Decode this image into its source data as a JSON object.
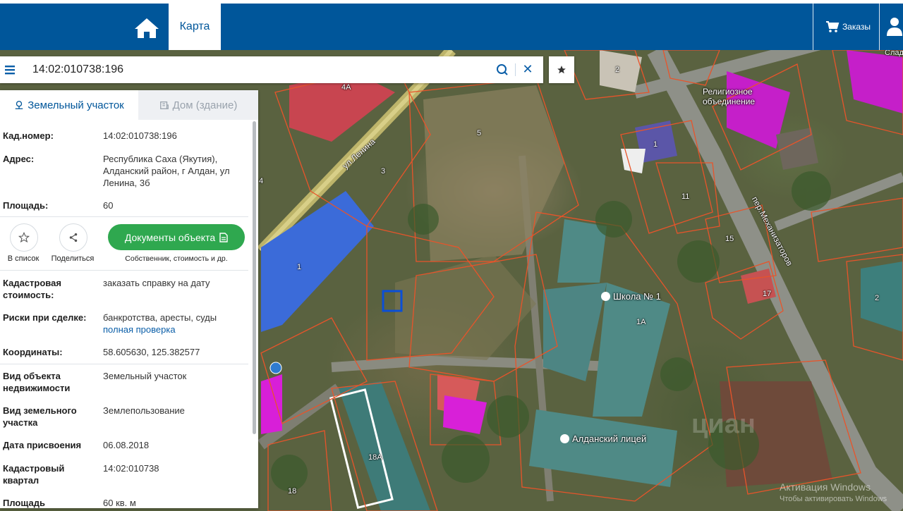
{
  "nav": {
    "tab_label": "Карта",
    "orders_label": "Заказы"
  },
  "search": {
    "value": "14:02:010738:196"
  },
  "panel": {
    "tab_land": "Земельный участок",
    "tab_house": "Дом (здание)",
    "rows": {
      "cad_number": {
        "label": "Кад.номер:",
        "value": "14:02:010738:196"
      },
      "address": {
        "label": "Адрес:",
        "value": "Республика Саха (Якутия), Алданский район, г Алдан, ул Ленина, 3б"
      },
      "area": {
        "label": "Площадь:",
        "value": "60"
      },
      "cad_value": {
        "label": "Кадастровая стоимость:",
        "value": "заказать справку на дату"
      },
      "risks": {
        "label": "Риски при сделке:",
        "value": "банкротства, аресты, суды",
        "link": "полная проверка"
      },
      "coords": {
        "label": "Координаты:",
        "value": "58.605630, 125.382577"
      },
      "object_type": {
        "label": "Вид объекта недвижимости",
        "value": "Земельный участок"
      },
      "land_type": {
        "label": "Вид земельного участка",
        "value": "Землепользование"
      },
      "assign_date": {
        "label": "Дата присвоения",
        "value": "06.08.2018"
      },
      "cad_quarter": {
        "label": "Кадастровый квартал",
        "value": "14:02:010738"
      },
      "refined_area": {
        "label": "Площадь уточненная",
        "value": "60 кв. м"
      }
    },
    "actions": {
      "add_list": "В список",
      "share": "Поделиться",
      "documents": "Документы объекта",
      "documents_sub": "Собственник, стоимость и др."
    }
  },
  "map": {
    "street_lenina": "ул.Ленина",
    "street_mekhanizatorov": "пер.Механизаторов",
    "labels": [
      "4А",
      "5",
      "3",
      "4",
      "1",
      "2",
      "1",
      "11",
      "15",
      "17",
      "2",
      "18А",
      "18",
      "1А",
      "Слад"
    ],
    "poi_religious": "Религиозное объединение",
    "poi_school": "Школа № 1",
    "poi_lyceum": "Алданский лицей",
    "watermark_line1": "Активация Windows",
    "watermark_line2": "Чтобы активировать Windows",
    "cian": "циан",
    "colors": {
      "navbar": "#00569a",
      "parcel_line": "#e8542a",
      "pink": "#d91ad9",
      "blue_roof": "#3a64d8"
    }
  }
}
